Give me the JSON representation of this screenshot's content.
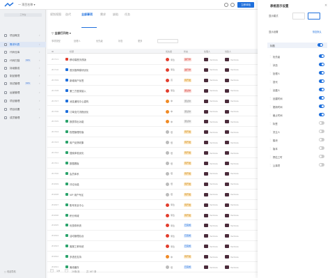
{
  "topbar": {
    "project": "一 项目名称 ▾",
    "action_btn": "立即体验"
  },
  "sidebar": {
    "search": "工作台",
    "items": [
      {
        "label": "项目概览",
        "badge": "",
        "active": false
      },
      {
        "label": "需求列表",
        "badge": "",
        "active": true
      },
      {
        "label": "代码仓库",
        "badge": "",
        "active": false
      },
      {
        "label": "代码扫描",
        "badge": "beta",
        "active": false
      },
      {
        "label": "持续集成",
        "badge": "",
        "active": false
      },
      {
        "label": "制品管理",
        "badge": "",
        "active": false
      },
      {
        "label": "测试管理",
        "badge": "beta",
        "active": false
      },
      {
        "label": "运营管理",
        "badge": "",
        "active": false
      },
      {
        "label": "项目管理",
        "badge": "",
        "active": false
      },
      {
        "label": "项目设置",
        "badge": "",
        "active": false
      },
      {
        "label": "成员管理",
        "badge": "",
        "active": false
      }
    ],
    "footer": "□ 收起导航"
  },
  "main": {
    "tabs": [
      "规划视图",
      "迭代",
      "全部事项",
      "需求",
      "缺陷",
      "任务"
    ],
    "filter_title": "▽ 全部打开的 ▾",
    "filters": [
      "事项类型",
      "处理人",
      "优先级",
      "状态",
      "更多"
    ],
    "columns": [
      "ID",
      "标题",
      "优先级",
      "状态",
      "处理人",
      "创建人"
    ],
    "rows": [
      {
        "id": "#1711",
        "title": "移动端首页改版",
        "prio": "紧急",
        "status": "进行中",
        "assignee": "Venture",
        "creator": "Venture",
        "tc": "#e23d2d",
        "pc": "#e23d2d",
        "sc": "#fbd7d2",
        "st": "#c33"
      },
      {
        "id": "#1710",
        "title": "首页推荐模块优化",
        "prio": "紧急",
        "status": "进行中",
        "assignee": "Venture",
        "creator": "Venture",
        "tc": "#1e6fdc",
        "pc": "#e23d2d",
        "sc": "#fbd7d2",
        "st": "#c33"
      },
      {
        "id": "#1709",
        "title": "新增用户标签",
        "prio": "高",
        "status": "待开发",
        "assignee": "Venture",
        "creator": "Venture",
        "tc": "#1e6fdc",
        "pc": "#e23d2d",
        "sc": "#fde9c7",
        "st": "#c77f00"
      },
      {
        "id": "#1708",
        "title": "第三方登录接入",
        "prio": "紧急",
        "status": "测试中",
        "assignee": "Venture",
        "creator": "Venture",
        "tc": "#1e6fdc",
        "pc": "#e23d2d",
        "sc": "#fbd7d2",
        "st": "#c33"
      },
      {
        "id": "#1707",
        "title": "消息通知中心重构",
        "prio": "中",
        "status": "测试中",
        "assignee": "Venture",
        "creator": "Venture",
        "tc": "#1e6fdc",
        "pc": "#f08a24",
        "sc": "#eee",
        "st": "#888"
      },
      {
        "id": "#1706",
        "title": "订单支付流程优化",
        "prio": "中",
        "status": "测试中",
        "assignee": "Venture",
        "creator": "Venture",
        "tc": "#1e6fdc",
        "pc": "#f08a24",
        "sc": "#eee",
        "st": "#888"
      },
      {
        "id": "#1705",
        "title": "报表导出功能",
        "prio": "中",
        "status": "测试中",
        "assignee": "Venture",
        "creator": "Venture",
        "tc": "#2aa36b",
        "pc": "#f08a24",
        "sc": "#eee",
        "st": "#888"
      },
      {
        "id": "#1704",
        "title": "权限管理改版",
        "prio": "低",
        "status": "待开发",
        "assignee": "Venture",
        "creator": "Venture",
        "tc": "#2aa36b",
        "pc": "#bbb",
        "sc": "#fde9c7",
        "st": "#c77f00"
      },
      {
        "id": "#1703",
        "title": "用户反馈收集",
        "prio": "低",
        "status": "待开发",
        "assignee": "Venture",
        "creator": "Venture",
        "tc": "#2aa36b",
        "pc": "#bbb",
        "sc": "#fde9c7",
        "st": "#c77f00"
      },
      {
        "id": "#1702",
        "title": "搜索体验优化",
        "prio": "低",
        "status": "待开发",
        "assignee": "Venture",
        "creator": "Venture",
        "tc": "#2aa36b",
        "pc": "#bbb",
        "sc": "#fde9c7",
        "st": "#c77f00"
      },
      {
        "id": "#1701",
        "title": "数据看板",
        "prio": "低",
        "status": "待开发",
        "assignee": "Venture",
        "creator": "Venture",
        "tc": "#2aa36b",
        "pc": "#bbb",
        "sc": "#fde9c7",
        "st": "#c77f00"
      },
      {
        "id": "#1700",
        "title": "会员体系",
        "prio": "低",
        "status": "待开发",
        "assignee": "Venture",
        "creator": "Venture",
        "tc": "#2aa36b",
        "pc": "#bbb",
        "sc": "#fde9c7",
        "st": "#c77f00"
      },
      {
        "id": "#1699",
        "title": "评论功能",
        "prio": "低",
        "status": "待开发",
        "assignee": "Venture",
        "creator": "Venture",
        "tc": "#2aa36b",
        "pc": "#bbb",
        "sc": "#fde9c7",
        "st": "#c77f00"
      },
      {
        "id": "#1698",
        "title": "VIP 用户专区",
        "prio": "低",
        "status": "待开发",
        "assignee": "Venture",
        "creator": "Venture",
        "tc": "#2aa36b",
        "pc": "#bbb",
        "sc": "#fde9c7",
        "st": "#c77f00"
      },
      {
        "id": "#1697",
        "title": "账号安全中心",
        "prio": "紧急",
        "status": "待开发",
        "assignee": "Venture",
        "creator": "Venture",
        "tc": "#2aa36b",
        "pc": "#e23d2d",
        "sc": "#fde9c7",
        "st": "#c77f00"
      },
      {
        "id": "#1696",
        "title": "积分商城",
        "prio": "紧急",
        "status": "待开发",
        "assignee": "Venture",
        "creator": "Venture",
        "tc": "#2aa36b",
        "pc": "#e23d2d",
        "sc": "#fde9c7",
        "st": "#c77f00"
      },
      {
        "id": "#1695",
        "title": "优惠券系统",
        "prio": "紧急",
        "status": "已完成",
        "assignee": "Venture",
        "creator": "Venture",
        "tc": "#2aa36b",
        "pc": "#e23d2d",
        "sc": "#dbe8fb",
        "st": "#1e6fdc"
      },
      {
        "id": "#1694",
        "title": "活动管理后台",
        "prio": "紧急",
        "status": "已完成",
        "assignee": "Venture",
        "creator": "Venture",
        "tc": "#2aa36b",
        "pc": "#e23d2d",
        "sc": "#dbe8fb",
        "st": "#1e6fdc"
      },
      {
        "id": "#1693",
        "title": "客服工单系统",
        "prio": "紧急",
        "status": "已完成",
        "assignee": "Venture",
        "creator": "Venture",
        "tc": "#2aa36b",
        "pc": "#e23d2d",
        "sc": "#dbe8fb",
        "st": "#1e6fdc"
      },
      {
        "id": "#1692",
        "title": "多语言支持",
        "prio": "中",
        "status": "待开发",
        "assignee": "Venture",
        "creator": "Venture",
        "tc": "#2aa36b",
        "pc": "#f08a24",
        "sc": "#fde9c7",
        "st": "#c77f00"
      },
      {
        "id": "#1691",
        "title": "离线缓存",
        "prio": "低",
        "status": "已完成",
        "assignee": "Venture",
        "creator": "Venture",
        "tc": "#2aa36b",
        "pc": "#bbb",
        "sc": "#dbe8fb",
        "st": "#1e6fdc"
      }
    ],
    "pager": {
      "prev": "‹",
      "page": "1/9",
      "next": "›",
      "size": "20条/页",
      "total": "共 167 条"
    }
  },
  "panel": {
    "title": "表格显示设置",
    "close": "×",
    "mode_label": "显示模式",
    "cols_label": "显示设置",
    "reset": "恢复默认",
    "fixed": "标题",
    "columns": [
      {
        "name": "优先级",
        "on": true
      },
      {
        "name": "状态",
        "on": true
      },
      {
        "name": "处理人",
        "on": true
      },
      {
        "name": "迭代",
        "on": true
      },
      {
        "name": "创建人",
        "on": true
      },
      {
        "name": "创建时间",
        "on": true
      },
      {
        "name": "更新时间",
        "on": true
      },
      {
        "name": "截止时间",
        "on": true
      },
      {
        "name": "标签",
        "on": false
      },
      {
        "name": "关注人",
        "on": false
      },
      {
        "name": "模块",
        "on": false
      },
      {
        "name": "版本",
        "on": false
      },
      {
        "name": "预估工时",
        "on": false
      },
      {
        "name": "父事项",
        "on": false
      }
    ]
  },
  "colors": {
    "accent": "#1e6fdc"
  }
}
